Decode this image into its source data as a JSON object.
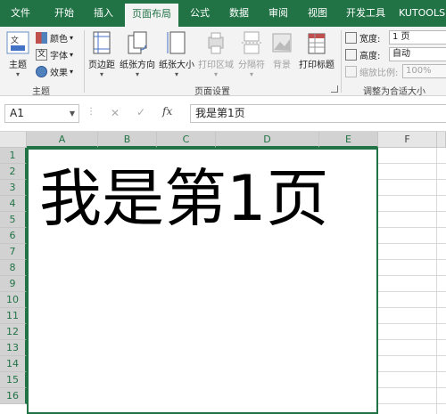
{
  "tabs": [
    "文件",
    "开始",
    "插入",
    "页面布局",
    "公式",
    "数据",
    "审阅",
    "视图",
    "开发工具",
    "KUTOOLS"
  ],
  "active_tab": "页面布局",
  "accent_color": "#217346",
  "ribbon": {
    "theme_group": {
      "themes_label": "主题",
      "colors_label": "颜色",
      "fonts_label": "字体",
      "effects_label": "效果",
      "group_label": "主题"
    },
    "page_setup": {
      "margins_label": "页边距",
      "orientation_label": "纸张方向",
      "size_label": "纸张大小",
      "print_area_label": "打印区域",
      "breaks_label": "分隔符",
      "background_label": "背景",
      "print_titles_label": "打印标题",
      "group_label": "页面设置"
    },
    "scale": {
      "width_label": "宽度:",
      "width_value": "1 页",
      "height_label": "高度:",
      "height_value": "自动",
      "scale_label": "缩放比例:",
      "scale_value": "100%",
      "group_label": "调整为合适大小"
    }
  },
  "formula_bar": {
    "name_box": "A1",
    "cancel_glyph": "✕",
    "enter_glyph": "✓",
    "fx_glyph": "fx",
    "content": "我是第1页"
  },
  "columns": [
    "A",
    "B",
    "C",
    "D",
    "E",
    "F"
  ],
  "rows": [
    "1",
    "2",
    "3",
    "4",
    "5",
    "6",
    "7",
    "8",
    "9",
    "10",
    "11",
    "12",
    "13",
    "14",
    "15",
    "16"
  ],
  "cell_text": "我是第1页"
}
